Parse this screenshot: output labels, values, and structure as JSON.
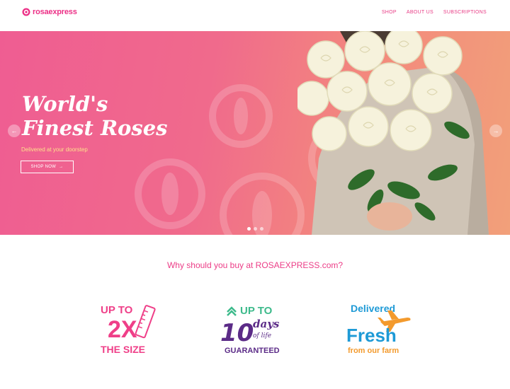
{
  "header": {
    "logo_text": "rosaexpress",
    "nav": [
      "SHOP",
      "ABOUT US",
      "SUBSCRIPTIONS"
    ]
  },
  "hero": {
    "title_line1": "World's",
    "title_line2": "Finest Roses",
    "subtitle": "Delivered at your doorstep",
    "button_label": "SHOP NOW",
    "button_arrow": "→",
    "prev_arrow": "←",
    "next_arrow": "→",
    "slide_count": 3,
    "active_slide": 1
  },
  "why_heading": "Why should you buy at ROSAEXPRESS.com?",
  "features": {
    "size": {
      "line1": "UP TO",
      "line2": "2X",
      "line3": "THE SIZE"
    },
    "days": {
      "line1": "UP TO",
      "number": "10",
      "days": "days",
      "of_life": "of life",
      "line3": "GUARANTEED"
    },
    "fresh": {
      "line1": "Delivered",
      "line2": "Fresh",
      "line3": "from our farm"
    }
  },
  "colors": {
    "brand_pink": "#ec2f86",
    "hero_start": "#ef5d92",
    "hero_end": "#f2a07a",
    "subtitle_yellow": "#ffe28a",
    "purple": "#5b2b87",
    "green": "#3dba8b",
    "blue": "#1e9ad6",
    "orange": "#f39a2d"
  }
}
